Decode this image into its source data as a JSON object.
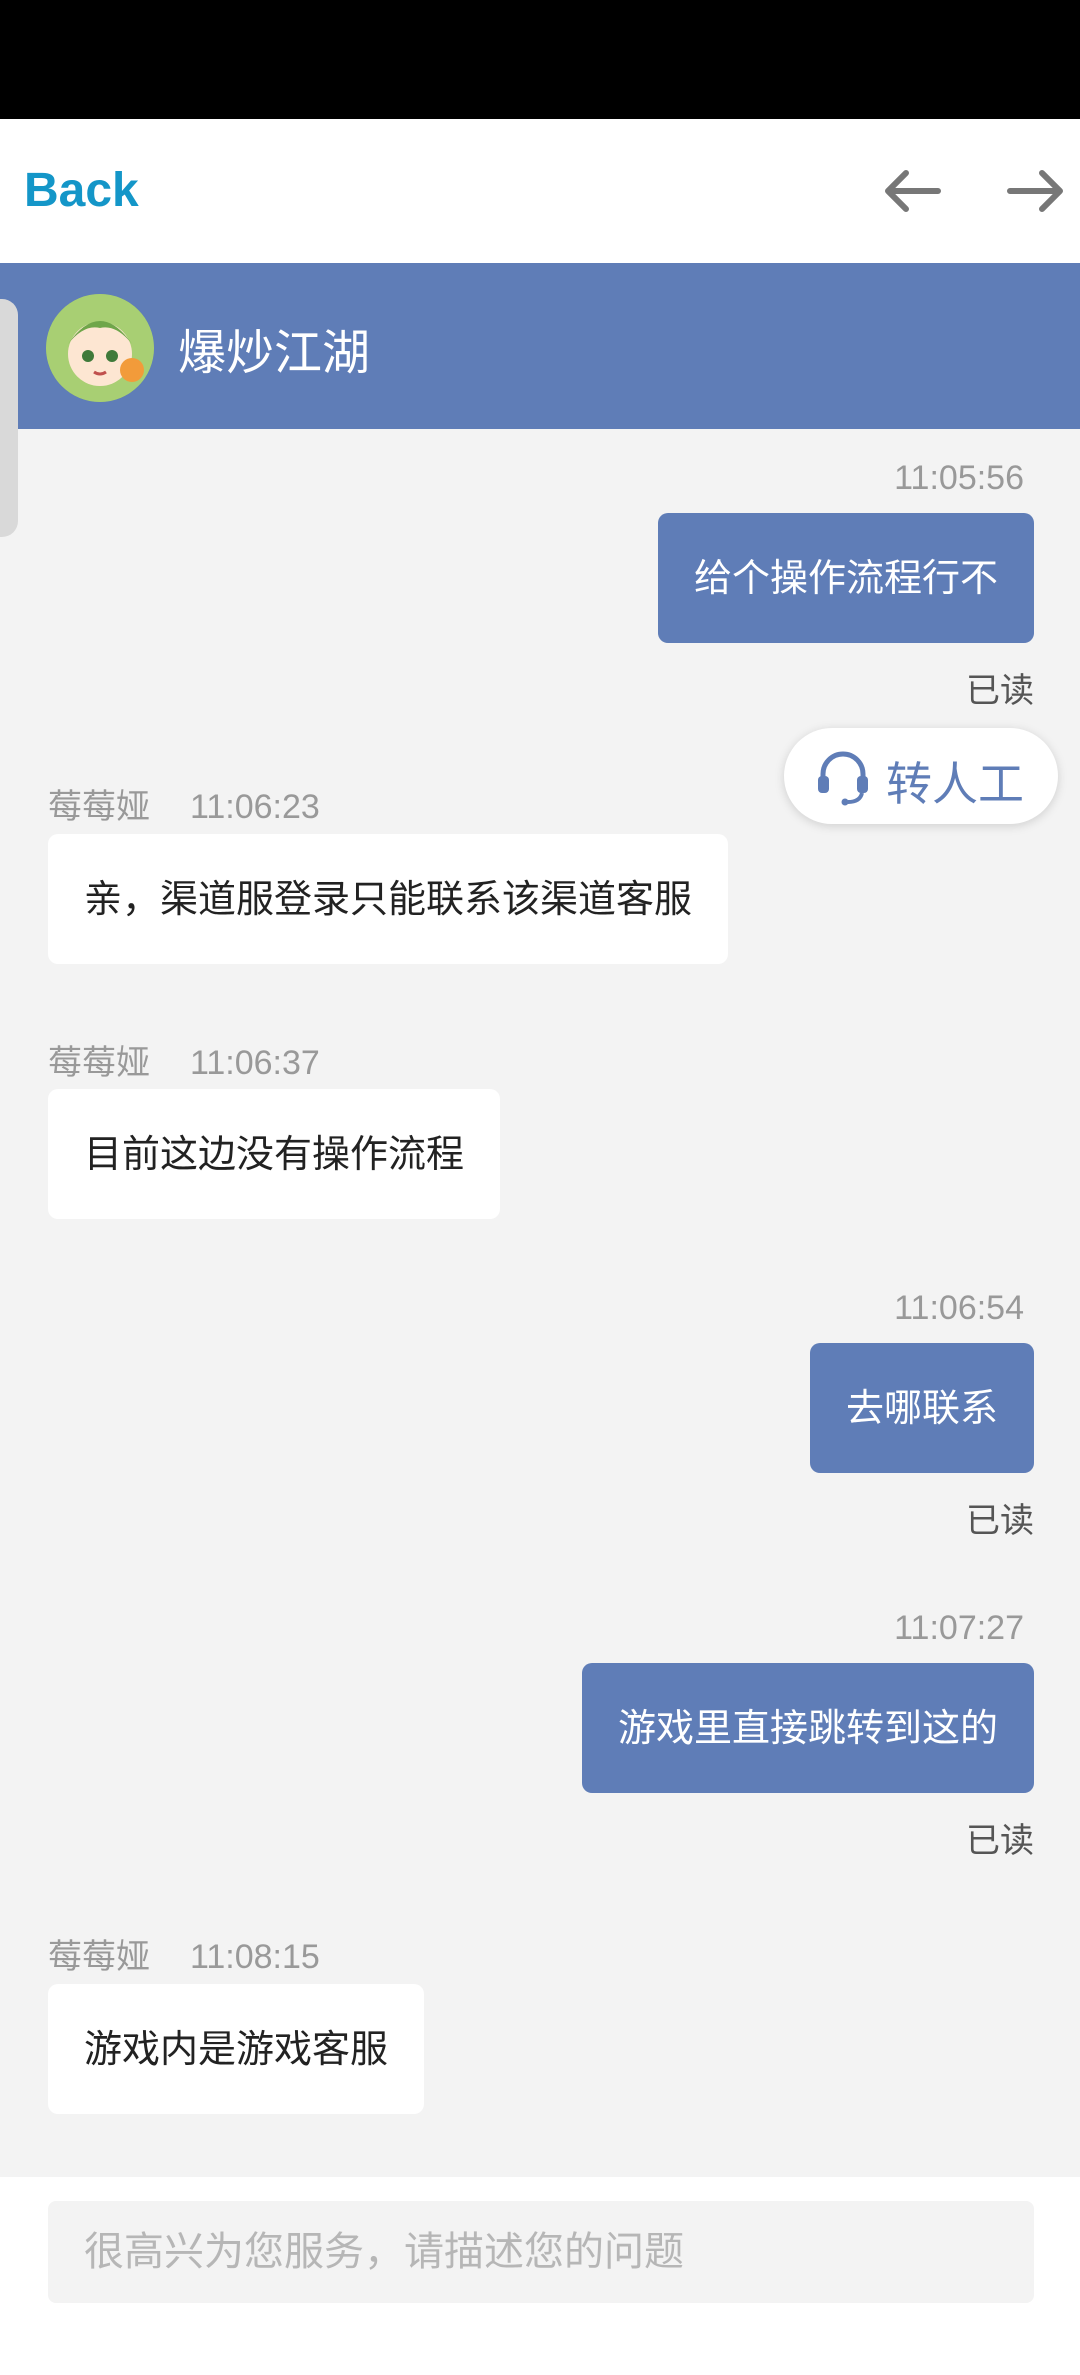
{
  "nav": {
    "back_label": "Back"
  },
  "header": {
    "title": "爆炒江湖"
  },
  "messages": [
    {
      "side": "out",
      "time": "11:05:56",
      "text": "给个操作流程行不",
      "status": "已读"
    },
    {
      "side": "in",
      "agent": "莓莓娅",
      "time": "11:06:23",
      "text": "亲，渠道服登录只能联系该渠道客服"
    },
    {
      "side": "in",
      "agent": "莓莓娅",
      "time": "11:06:37",
      "text": "目前这边没有操作流程"
    },
    {
      "side": "out",
      "time": "11:06:54",
      "text": "去哪联系",
      "status": "已读"
    },
    {
      "side": "out",
      "time": "11:07:27",
      "text": "游戏里直接跳转到这的",
      "status": "已读"
    },
    {
      "side": "in",
      "agent": "莓莓娅",
      "time": "11:08:15",
      "text": "游戏内是游戏客服"
    }
  ],
  "transfer": {
    "label": "转人工",
    "icon": "headset-icon"
  },
  "composer": {
    "placeholder": "很高兴为您服务，请描述您的问题"
  },
  "colors": {
    "accent": "#5f7db7",
    "back_link": "#1496c8",
    "background": "#f3f3f3"
  }
}
